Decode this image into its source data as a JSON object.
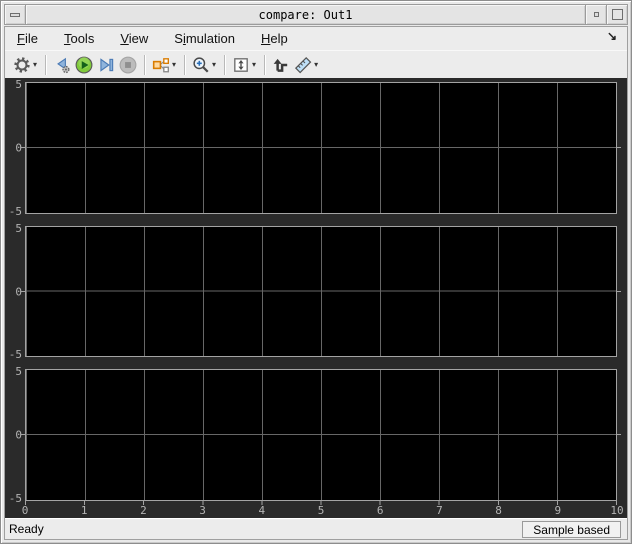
{
  "window": {
    "title": "compare: Out1"
  },
  "titlebar": {
    "buttons": [
      "window-menu",
      "minimize",
      "maximize"
    ]
  },
  "menu": {
    "items": [
      {
        "pre": "",
        "accel": "F",
        "post": "ile"
      },
      {
        "pre": "",
        "accel": "T",
        "post": "ools"
      },
      {
        "pre": "",
        "accel": "V",
        "post": "iew"
      },
      {
        "pre": "S",
        "accel": "i",
        "post": "mulation"
      },
      {
        "pre": "",
        "accel": "H",
        "post": "elp"
      }
    ],
    "dock_arrow": "↘"
  },
  "toolbar": {
    "icons": [
      "parameters-gear",
      "step-back",
      "run",
      "step-forward",
      "stop",
      "signal-selector",
      "zoom",
      "fit-to-view",
      "trigger",
      "cursor-measurements"
    ],
    "dropdown_glyph": "▾"
  },
  "scope": {
    "displays": 3,
    "ylim": [
      -5,
      5
    ],
    "xlim": [
      0,
      10
    ],
    "yticks": [
      "5",
      "0",
      "-5"
    ],
    "xticks": [
      "0",
      "1",
      "2",
      "3",
      "4",
      "5",
      "6",
      "7",
      "8",
      "9",
      "10"
    ],
    "grid": true,
    "signals": []
  },
  "statusbar": {
    "status": "Ready",
    "mode": "Sample based"
  },
  "colors": {
    "plot_bg": "#000000",
    "panel_bg": "#2a2a2a",
    "grid": "#676767",
    "tick_label": "#b4b4b4",
    "chrome": "#ececec",
    "run_green": "#6fbf44",
    "step_blue": "#8fb4dc",
    "selector_orange": "#d97b00"
  }
}
